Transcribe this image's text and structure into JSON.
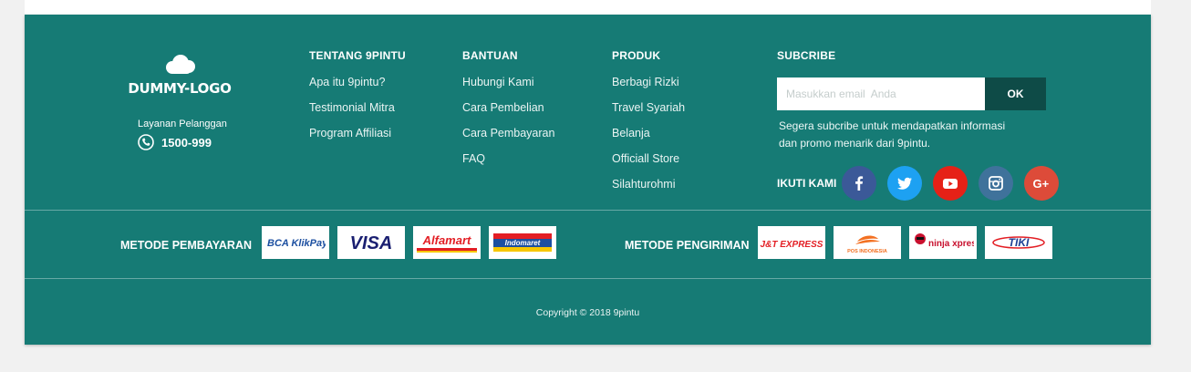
{
  "brand": {
    "logo_text": "DUMMY-LOGO"
  },
  "customer_service": {
    "label": "Layanan Pelanggan",
    "phone": "1500-999"
  },
  "columns": [
    {
      "title": "TENTANG 9PINTU",
      "items": [
        "Apa itu 9pintu?",
        "Testimonial Mitra",
        "Program Affiliasi"
      ]
    },
    {
      "title": "BANTUAN",
      "items": [
        "Hubungi Kami",
        "Cara Pembelian",
        "Cara Pembayaran",
        "FAQ"
      ]
    },
    {
      "title": "PRODUK",
      "items": [
        "Berbagi Rizki",
        "Travel Syariah",
        "Belanja",
        "Officiall Store",
        "Silahturohmi"
      ]
    }
  ],
  "subscribe": {
    "title": "SUBCRIBE",
    "placeholder": "Masukkan email  Anda",
    "button": "OK",
    "desc_line1": "Segera subcribe untuk mendapatkan informasi",
    "desc_line2": "dan promo menarik dari 9pintu."
  },
  "follow": {
    "label": "IKUTI KAMI",
    "socials": [
      {
        "name": "facebook-icon",
        "color": "#3b5998"
      },
      {
        "name": "twitter-icon",
        "color": "#1da1f2"
      },
      {
        "name": "youtube-icon",
        "color": "#e62117"
      },
      {
        "name": "instagram-icon",
        "color": "#3f729b"
      },
      {
        "name": "google-plus-icon",
        "color": "#dd4b39"
      }
    ]
  },
  "payment": {
    "label": "METODE PEMBAYARAN",
    "methods": [
      "BCA KlikPay",
      "VISA",
      "Alfamart",
      "Indomaret"
    ]
  },
  "shipping": {
    "label": "METODE PENGIRIMAN",
    "methods": [
      "J&T EXPRESS",
      "POS INDONESIA",
      "ninja xpress",
      "TIKI"
    ]
  },
  "copyright": "Copyright © 2018 9pintu",
  "colors": {
    "footer_bg": "#167b75",
    "button_bg": "#0e4b47",
    "page_bg": "#f1f1f1"
  }
}
